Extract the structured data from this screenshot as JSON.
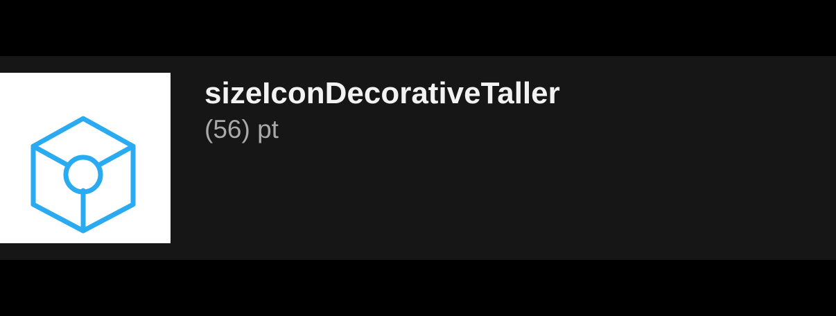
{
  "token": {
    "name": "sizeIconDecorativeTaller",
    "value": "(56) pt",
    "icon": "cube-icon",
    "icon_color": "#2aaaf0",
    "thumb_background": "#ffffff",
    "row_background": "#161616"
  }
}
